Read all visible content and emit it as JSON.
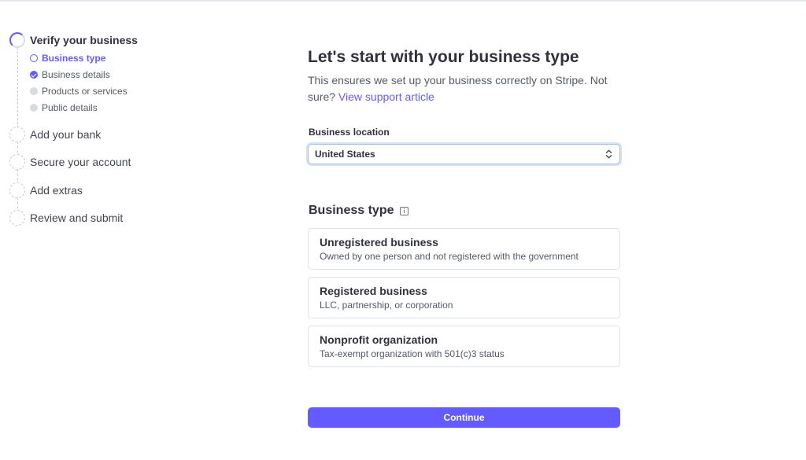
{
  "stepper": {
    "steps": [
      {
        "label": "Verify your business",
        "state": "active"
      },
      {
        "label": "Add your bank",
        "state": "pending"
      },
      {
        "label": "Secure your account",
        "state": "pending"
      },
      {
        "label": "Add extras",
        "state": "pending"
      },
      {
        "label": "Review and submit",
        "state": "pending"
      }
    ],
    "substeps": [
      {
        "label": "Business type",
        "state": "current"
      },
      {
        "label": "Business details",
        "state": "complete"
      },
      {
        "label": "Products or services",
        "state": "pending"
      },
      {
        "label": "Public details",
        "state": "pending"
      }
    ]
  },
  "main": {
    "title": "Let's start with your business type",
    "subtitle_text": "This ensures we set up your business correctly on Stripe. Not sure?",
    "support_link": "View support article",
    "location": {
      "label": "Business location",
      "value": "United States"
    },
    "business_type": {
      "heading": "Business type",
      "options": [
        {
          "name": "Unregistered business",
          "description": "Owned by one person and not registered with the government"
        },
        {
          "name": "Registered business",
          "description": "LLC, partnership, or corporation"
        },
        {
          "name": "Nonprofit organization",
          "description": "Tax-exempt organization with 501(c)3 status"
        }
      ]
    },
    "continue_label": "Continue"
  },
  "colors": {
    "accent": "#635bff",
    "text": "#30313d",
    "muted": "#545969"
  },
  "icons": {
    "step_active": "progress-ring-icon",
    "step_pending": "dashed-circle-icon",
    "substep_current": "ring-icon",
    "substep_complete": "check-circle-icon",
    "select_chevron": "chevron-up-down-icon",
    "info": "info-icon"
  }
}
